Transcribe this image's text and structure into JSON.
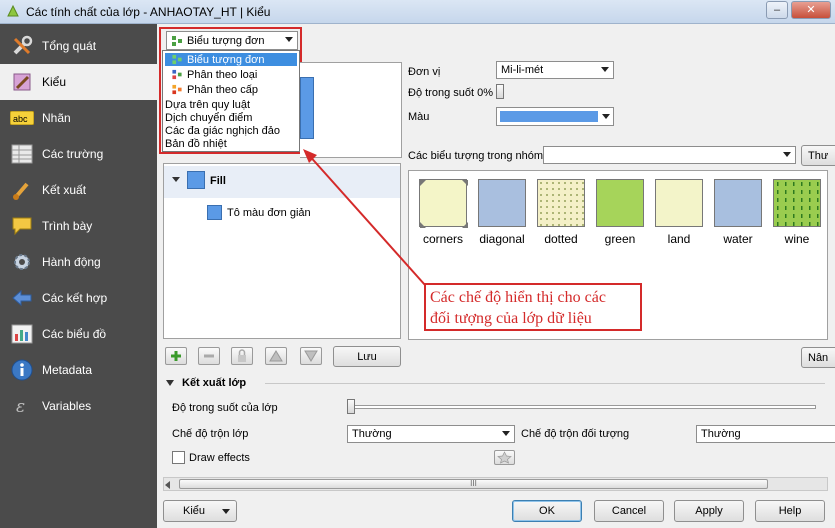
{
  "window": {
    "title": "Các tính chất của lớp - ANHAOTAY_HT | Kiểu",
    "min": "–",
    "max": "□",
    "close": "✕"
  },
  "sidebar": {
    "items": [
      {
        "label": "Tổng quát",
        "icon": "wrench-icon"
      },
      {
        "label": "Kiểu",
        "icon": "paintbrush-icon"
      },
      {
        "label": "Nhãn",
        "icon": "abc-label-icon"
      },
      {
        "label": "Các trường",
        "icon": "table-fields-icon"
      },
      {
        "label": "Kết xuất",
        "icon": "brush-render-icon"
      },
      {
        "label": "Trình bày",
        "icon": "speech-bubble-icon"
      },
      {
        "label": "Hành động",
        "icon": "gear-action-icon"
      },
      {
        "label": "Các kết hợp",
        "icon": "join-icon"
      },
      {
        "label": "Các biểu đồ",
        "icon": "diagram-icon"
      },
      {
        "label": "Metadata",
        "icon": "info-icon"
      },
      {
        "label": "Variables",
        "icon": "variables-icon"
      }
    ]
  },
  "renderer": {
    "selected": "Biểu tượng đơn",
    "options": [
      "Biểu tượng đơn",
      "Phân theo loại",
      "Phân theo cấp",
      "Dựa trên quy luật",
      "Dịch chuyển điểm",
      "Các đa giác nghịch đảo",
      "Bản đồ nhiệt"
    ]
  },
  "symbol_tree": {
    "layer_label": "Fill",
    "sublayer_label": "Tô màu đơn giản"
  },
  "props": {
    "unit_label": "Đơn vị",
    "unit_value": "Mi-li-mét",
    "opacity_label": "Độ trong suốt 0%",
    "color_label": "Màu",
    "group_label": "Các biểu tượng trong nhóm",
    "group_value": "",
    "group_button": "Thư"
  },
  "symbols": [
    {
      "name": "corners",
      "color": "#f4f5c8"
    },
    {
      "name": "diagonal",
      "color": "#a9bfdf"
    },
    {
      "name": "dotted",
      "color": "#f4f0c7"
    },
    {
      "name": "green",
      "color": "#a6d45a"
    },
    {
      "name": "land",
      "color": "#f3f4c9"
    },
    {
      "name": "water",
      "color": "#a8bfdf"
    },
    {
      "name": "wine",
      "color": "#9acc4f"
    }
  ],
  "annotation": {
    "text_line1": "Các chế độ hiển thị cho các",
    "text_line2": "đối tượng của lớp dữ liệu"
  },
  "toolbar": {
    "save_label": "Lưu",
    "advanced_label": "Nân"
  },
  "layer_render": {
    "section_title": "Kết xuất lớp",
    "opacity_label": "Độ trong suốt của lớp",
    "blend_layer_label": "Chế độ trộn lớp",
    "blend_layer_value": "Thường",
    "blend_feature_label": "Chế độ trộn đối tượng",
    "blend_feature_value": "Thường",
    "draw_effects_label": "Draw effects",
    "scroll_grip": "III"
  },
  "footer": {
    "style_button": "Kiểu",
    "ok": "OK",
    "cancel": "Cancel",
    "apply": "Apply",
    "help": "Help"
  },
  "colors": {
    "accent": "#5b9ae6",
    "sidebar_bg": "#4b4b4b",
    "annotation_red": "#d42a2a",
    "selection": "#3d8ee0"
  }
}
